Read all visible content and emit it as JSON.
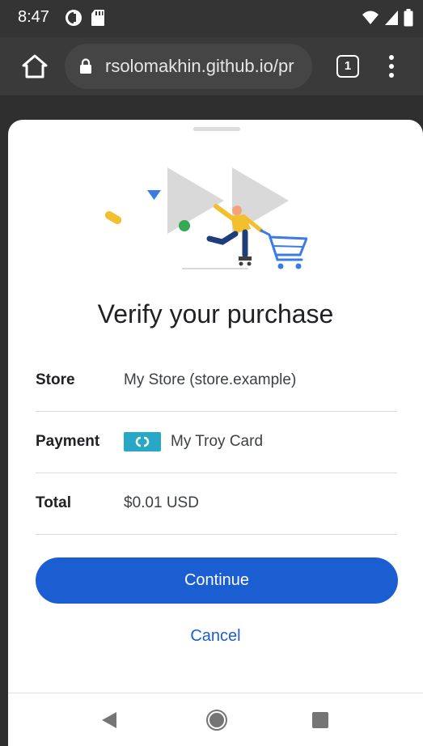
{
  "status_bar": {
    "time": "8:47",
    "left_icons": [
      "data-saver-icon",
      "sd-card-icon"
    ],
    "right_icons": [
      "wifi-icon",
      "signal-icon",
      "battery-icon"
    ]
  },
  "browser": {
    "url": "rsolomakhin.github.io/pr",
    "tab_count": "1",
    "icons": [
      "home-icon",
      "lock-icon",
      "tab-switcher-icon",
      "more-vert-icon"
    ]
  },
  "sheet": {
    "title": "Verify your purchase",
    "rows": [
      {
        "label": "Store",
        "value": "My Store (store.example)"
      },
      {
        "label": "Payment",
        "value": "My Troy Card",
        "icon": "troy-card-icon"
      },
      {
        "label": "Total",
        "value": "$0.01 USD"
      }
    ],
    "continue_label": "Continue",
    "cancel_label": "Cancel"
  },
  "nav_bar": {
    "icons": [
      "back-icon",
      "home-circle-icon",
      "recents-icon"
    ]
  },
  "colors": {
    "accent": "#1a5ed1",
    "card": "#29a7c6",
    "illustration_yellow": "#f2bf2f",
    "illustration_blue": "#3b7be8",
    "illustration_green": "#34a853",
    "illustration_grey": "#d9d9d9"
  }
}
